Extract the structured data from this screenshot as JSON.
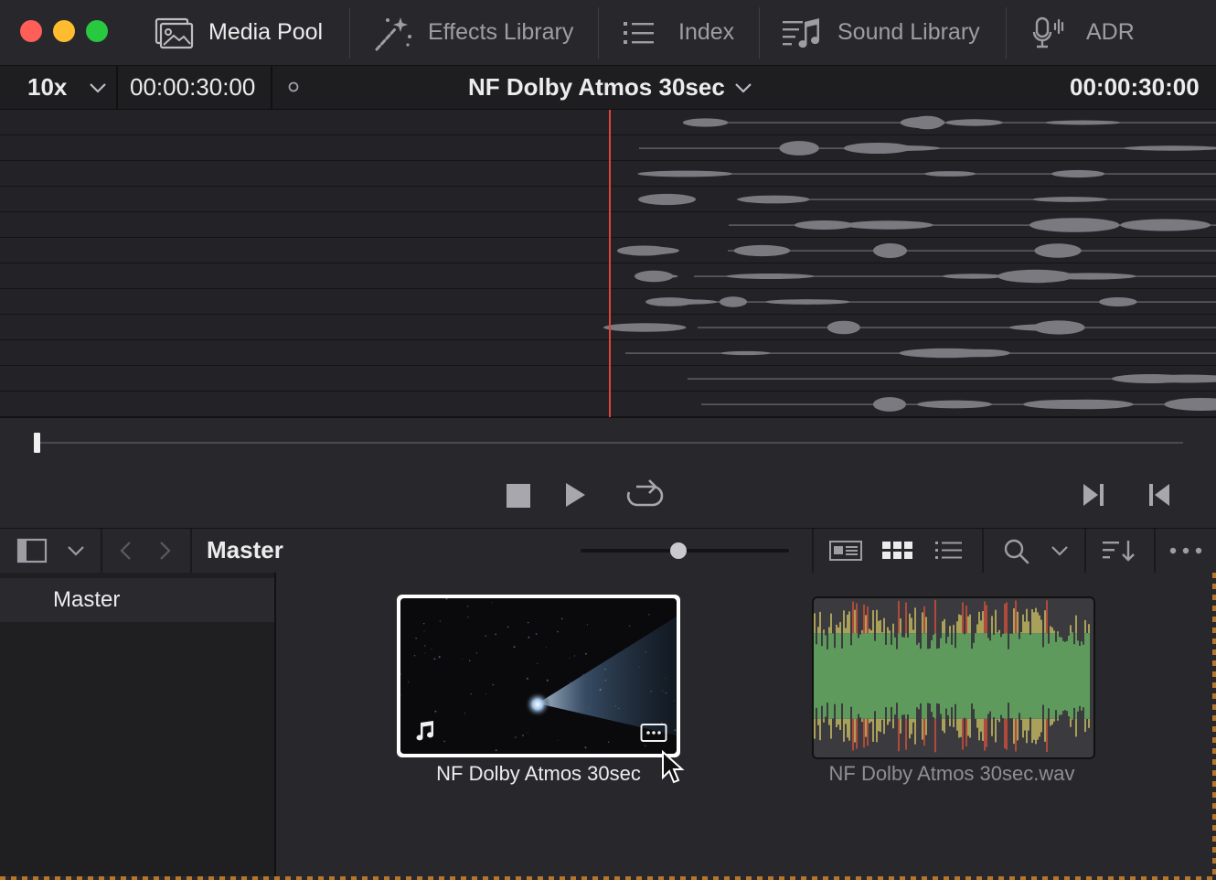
{
  "window": {
    "traffic_lights": {
      "close": "#ff5f57",
      "minimize": "#febc2e",
      "zoom": "#28c840"
    }
  },
  "tabs": [
    {
      "label": "Media Pool",
      "icon": "media-pool-icon",
      "active": true
    },
    {
      "label": "Effects Library",
      "icon": "magic-wand-icon",
      "active": false
    },
    {
      "label": "Index",
      "icon": "list-icon",
      "active": false
    },
    {
      "label": "Sound Library",
      "icon": "music-list-icon",
      "active": false
    },
    {
      "label": "ADR",
      "icon": "microphone-icon",
      "active": false
    }
  ],
  "viewer": {
    "zoom": "10x",
    "source_timecode": "00:00:30:00",
    "clip_title": "NF Dolby Atmos 30sec",
    "duration_timecode": "00:00:30:00",
    "playhead_color": "#e2433b",
    "scrub_position": 0.0
  },
  "transport": {
    "buttons": [
      "stop-icon",
      "play-icon",
      "loop-icon",
      "jump-to-end-icon",
      "jump-to-start-icon"
    ]
  },
  "media_pool": {
    "bin_title": "Master",
    "bins": [
      {
        "label": "Master",
        "selected": true
      }
    ],
    "thumb_size_slider": 0.47,
    "clips": [
      {
        "name": "NF Dolby Atmos 30sec",
        "selected": true,
        "type": "video"
      },
      {
        "name": "NF Dolby Atmos 30sec.wav",
        "selected": false,
        "type": "audio"
      }
    ]
  },
  "colors": {
    "waveform_green": "#5e9a5c",
    "waveform_yellow": "#a9a05a",
    "waveform_red": "#b04a3a",
    "accent_orange": "#b8762a"
  }
}
